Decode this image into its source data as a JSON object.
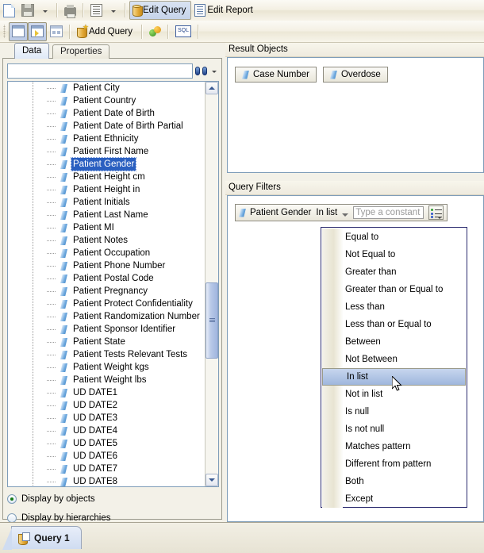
{
  "toolbar_main": {
    "items": [
      {
        "name": "new-document",
        "icon": "document-icon",
        "label": ""
      },
      {
        "name": "save",
        "icon": "save-icon",
        "label": ""
      },
      {
        "name": "save-dropdown",
        "icon": "chevron-down-icon",
        "label": ""
      },
      {
        "name": "print",
        "icon": "printer-icon",
        "label": ""
      },
      {
        "name": "print-layout",
        "icon": "page-list-icon",
        "label": ""
      },
      {
        "name": "print-layout-dropdown",
        "icon": "chevron-down-icon",
        "label": ""
      }
    ],
    "edit_query_label": "Edit Query",
    "edit_report_label": "Edit Report"
  },
  "toolbar_query": {
    "add_query_label": "Add Query",
    "sql_label": "SQL"
  },
  "left_panel": {
    "tabs": [
      {
        "label": "Data",
        "active": true
      },
      {
        "label": "Properties",
        "active": false
      }
    ],
    "search": {
      "value": "",
      "placeholder": ""
    },
    "tree_items": [
      "Patient City",
      "Patient Country",
      "Patient Date of Birth",
      "Patient Date of Birth Partial",
      "Patient Ethnicity",
      "Patient First Name",
      "Patient Gender",
      "Patient Height cm",
      "Patient Height in",
      "Patient Initials",
      "Patient Last Name",
      "Patient MI",
      "Patient Notes",
      "Patient Occupation",
      "Patient Phone Number",
      "Patient Postal Code",
      "Patient Pregnancy",
      "Patient Protect Confidentiality",
      "Patient Randomization Number",
      "Patient Sponsor Identifier",
      "Patient State",
      "Patient Tests Relevant Tests",
      "Patient Weight kgs",
      "Patient Weight lbs",
      "UD DATE1",
      "UD DATE2",
      "UD DATE3",
      "UD DATE4",
      "UD DATE5",
      "UD DATE6",
      "UD DATE7",
      "UD DATE8"
    ],
    "selected_item": "Patient Gender",
    "display_options": [
      {
        "label": "Display by objects",
        "selected": true
      },
      {
        "label": "Display by hierarchies",
        "selected": false
      }
    ]
  },
  "result_objects": {
    "header": "Result Objects",
    "objects": [
      "Case Number",
      "Overdose"
    ]
  },
  "query_filters": {
    "header": "Query Filters",
    "filter": {
      "object": "Patient Gender",
      "operator": "In list",
      "value": "",
      "value_placeholder": "Type a constant"
    }
  },
  "operator_menu": {
    "items": [
      "Equal to",
      "Not Equal to",
      "Greater than",
      "Greater than or Equal to",
      "Less than",
      "Less than or Equal to",
      "Between",
      "Not Between",
      "In list",
      "Not in list",
      "Is null",
      "Is not null",
      "Matches pattern",
      "Different from pattern",
      "Both",
      "Except"
    ],
    "highlighted": "In list"
  },
  "bottom_tabs": {
    "tabs": [
      {
        "label": "Query 1",
        "active": true
      }
    ]
  },
  "colors": {
    "selection_blue": "#2a5fc0",
    "menu_highlight": "#9fb7dd",
    "chrome": "#f3f1e8",
    "border": "#7f9db9"
  }
}
